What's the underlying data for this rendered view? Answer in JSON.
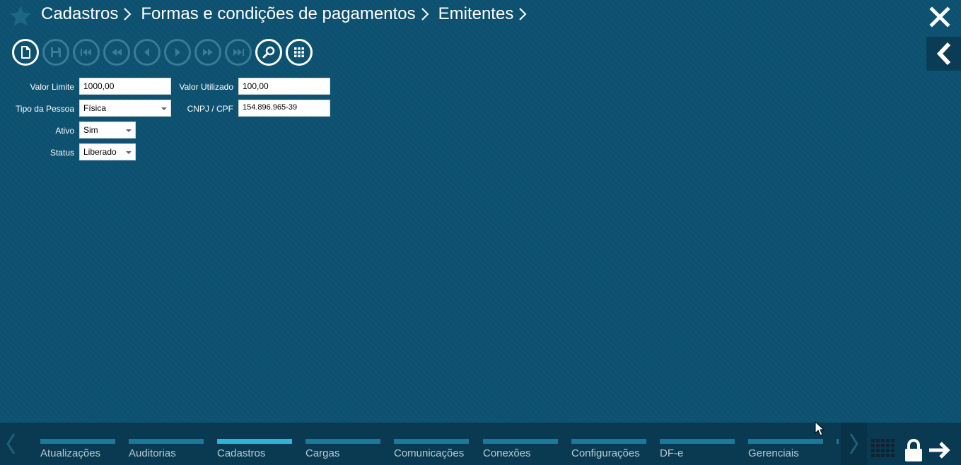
{
  "header": {
    "breadcrumb": [
      "Cadastros",
      "Formas e condições de pagamentos",
      "Emitentes"
    ]
  },
  "toolbar": {
    "buttons": [
      {
        "icon": "new-document-icon",
        "enabled": true
      },
      {
        "icon": "save-icon",
        "enabled": false
      },
      {
        "icon": "first-record-icon",
        "enabled": false
      },
      {
        "icon": "rewind-icon",
        "enabled": false
      },
      {
        "icon": "previous-record-icon",
        "enabled": false
      },
      {
        "icon": "next-record-icon",
        "enabled": false
      },
      {
        "icon": "fast-forward-icon",
        "enabled": false
      },
      {
        "icon": "last-record-icon",
        "enabled": false
      },
      {
        "icon": "search-icon",
        "enabled": true
      },
      {
        "icon": "grid-icon",
        "enabled": true
      }
    ]
  },
  "form": {
    "valor_limite": {
      "label": "Valor Limite",
      "value": "1000,00"
    },
    "valor_utilizado": {
      "label": "Valor Utilizado",
      "value": "100,00"
    },
    "tipo_pessoa": {
      "label": "Tipo da Pessoa",
      "value": "Física"
    },
    "cnpj_cpf": {
      "label": "CNPJ / CPF",
      "value": "154.896.965-39"
    },
    "ativo": {
      "label": "Ativo",
      "value": "Sim"
    },
    "status": {
      "label": "Status",
      "value": "Liberado"
    }
  },
  "taskbar": {
    "modules": [
      {
        "label": "Atualizações",
        "active": false
      },
      {
        "label": "Auditorias",
        "active": false
      },
      {
        "label": "Cadastros",
        "active": true
      },
      {
        "label": "Cargas",
        "active": false
      },
      {
        "label": "Comunicações",
        "active": false
      },
      {
        "label": "Conexões",
        "active": false
      },
      {
        "label": "Configurações",
        "active": false
      },
      {
        "label": "DF-e",
        "active": false
      },
      {
        "label": "Gerenciais",
        "active": false
      }
    ]
  },
  "colors": {
    "background": "#0d5170",
    "taskbar": "#0a3a52",
    "module_bar": "#1b7a98",
    "module_bar_active": "#2fb4d9"
  }
}
